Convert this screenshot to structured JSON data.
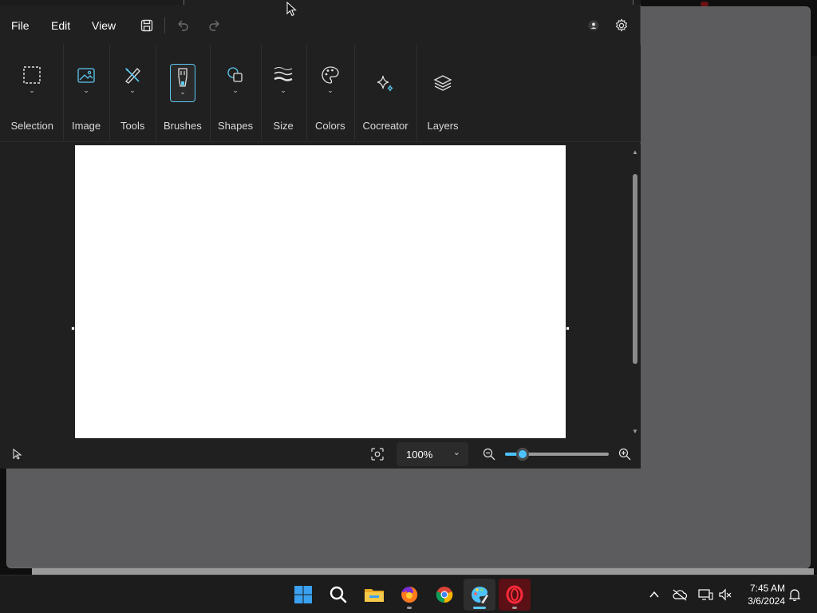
{
  "menu": {
    "file": "File",
    "edit": "Edit",
    "view": "View"
  },
  "ribbon": {
    "groups": [
      {
        "label": "Selection",
        "icon": "selection-icon"
      },
      {
        "label": "Image",
        "icon": "image-icon"
      },
      {
        "label": "Tools",
        "icon": "tools-icon"
      },
      {
        "label": "Brushes",
        "icon": "brush-icon",
        "selected": true
      },
      {
        "label": "Shapes",
        "icon": "shapes-icon"
      },
      {
        "label": "Size",
        "icon": "size-icon"
      },
      {
        "label": "Colors",
        "icon": "palette-icon"
      },
      {
        "label": "Cocreator",
        "icon": "sparkle-icon"
      },
      {
        "label": "Layers",
        "icon": "layers-icon"
      }
    ]
  },
  "status": {
    "zoom": "100%",
    "zoom_level": 0.17
  },
  "clock": {
    "time": "7:45 AM",
    "date": "3/6/2024"
  },
  "colors": {
    "accent": "#4cc2ff",
    "app_bg": "#202020",
    "canvas": "#ffffff"
  }
}
